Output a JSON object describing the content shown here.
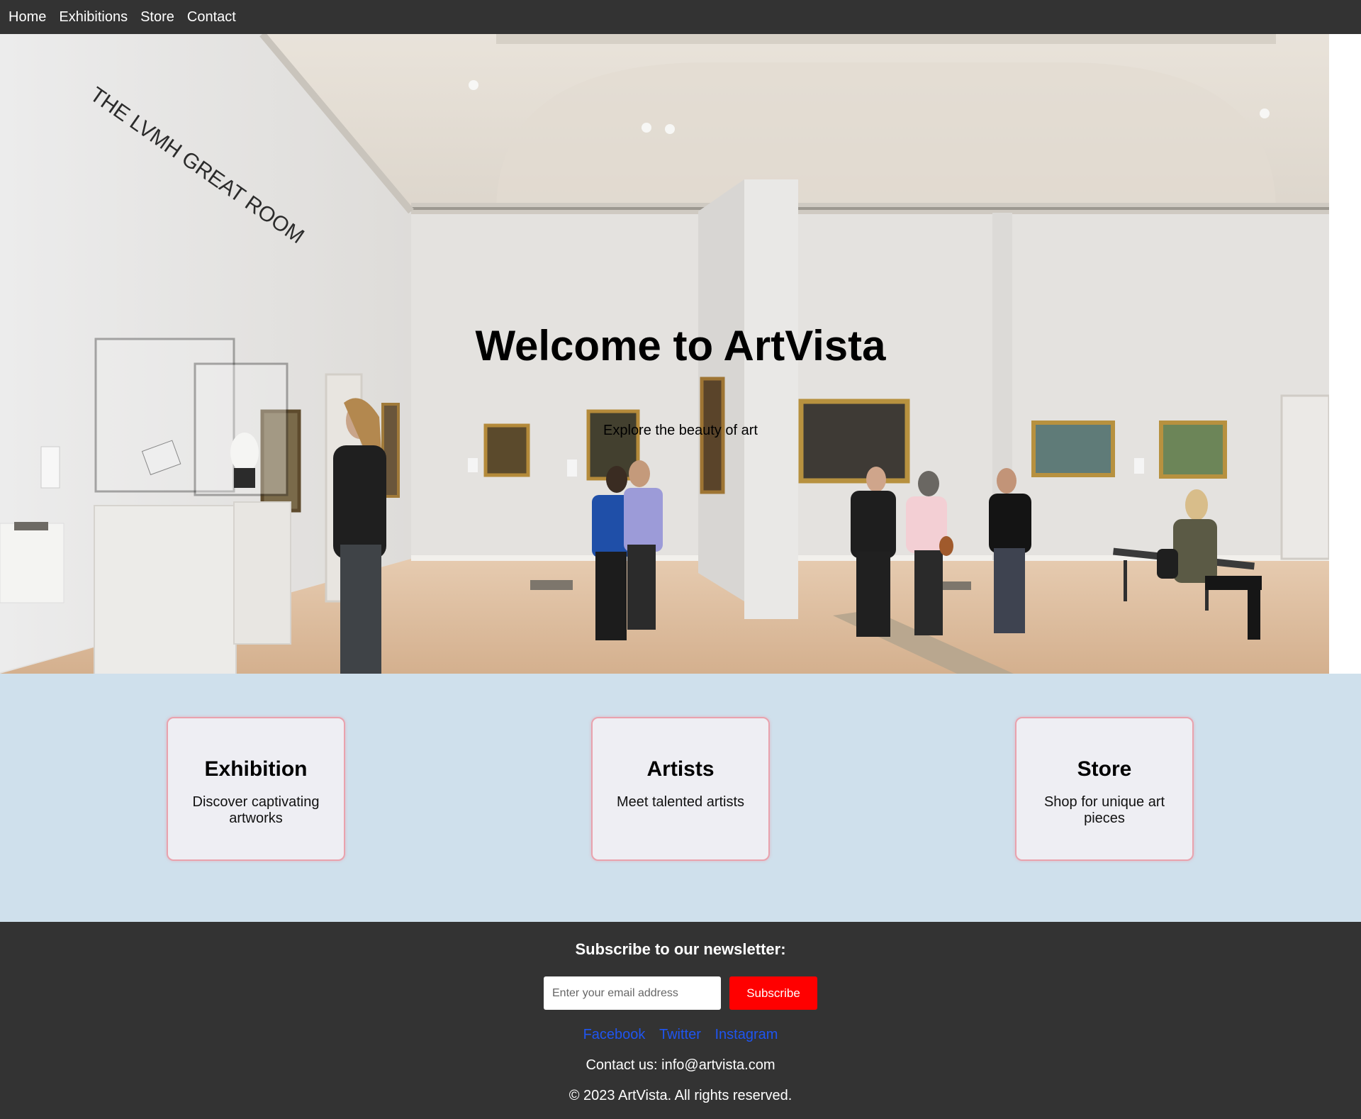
{
  "nav": {
    "items": [
      {
        "label": "Home"
      },
      {
        "label": "Exhibitions"
      },
      {
        "label": "Store"
      },
      {
        "label": "Contact"
      }
    ]
  },
  "hero": {
    "title": "Welcome to ArtVista",
    "subtitle": "Explore the beauty of art",
    "wall_sign": "THE LVMH GREAT ROOM"
  },
  "features": {
    "cards": [
      {
        "title": "Exhibition",
        "description": "Discover captivating artworks"
      },
      {
        "title": "Artists",
        "description": "Meet talented artists"
      },
      {
        "title": "Store",
        "description": "Shop for unique art pieces"
      }
    ]
  },
  "footer": {
    "newsletter_title": "Subscribe to our newsletter:",
    "email_placeholder": "Enter your email address",
    "subscribe_label": "Subscribe",
    "socials": [
      {
        "label": "Facebook"
      },
      {
        "label": "Twitter"
      },
      {
        "label": "Instagram"
      }
    ],
    "contact": "Contact us: info@artvista.com",
    "copyright": "© 2023 ArtVista. All rights reserved."
  },
  "colors": {
    "nav_bg": "#333333",
    "features_bg": "#cfe0ec",
    "card_border": "#e9a2ad",
    "subscribe_btn": "#ff0000",
    "social_link": "#1f55f0"
  }
}
